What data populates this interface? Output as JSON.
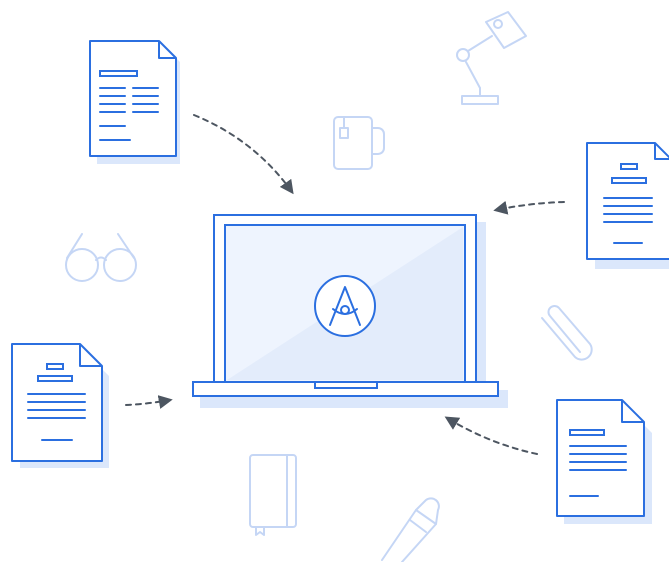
{
  "colors": {
    "primary": "#2b6fe0",
    "shadow": "#dbe7fb",
    "faint": "#c5d6f5",
    "arrow": "#4d5661",
    "screen_fill": "#eef4fe",
    "background": "#ffffff"
  },
  "icons": {
    "center": "compass-logo-icon",
    "decor": [
      "desk-lamp-icon",
      "mug-icon",
      "glasses-icon",
      "paperclip-icon",
      "notebook-icon",
      "pen-icon"
    ],
    "documents": [
      "document-icon",
      "document-icon",
      "document-icon",
      "document-icon"
    ]
  }
}
